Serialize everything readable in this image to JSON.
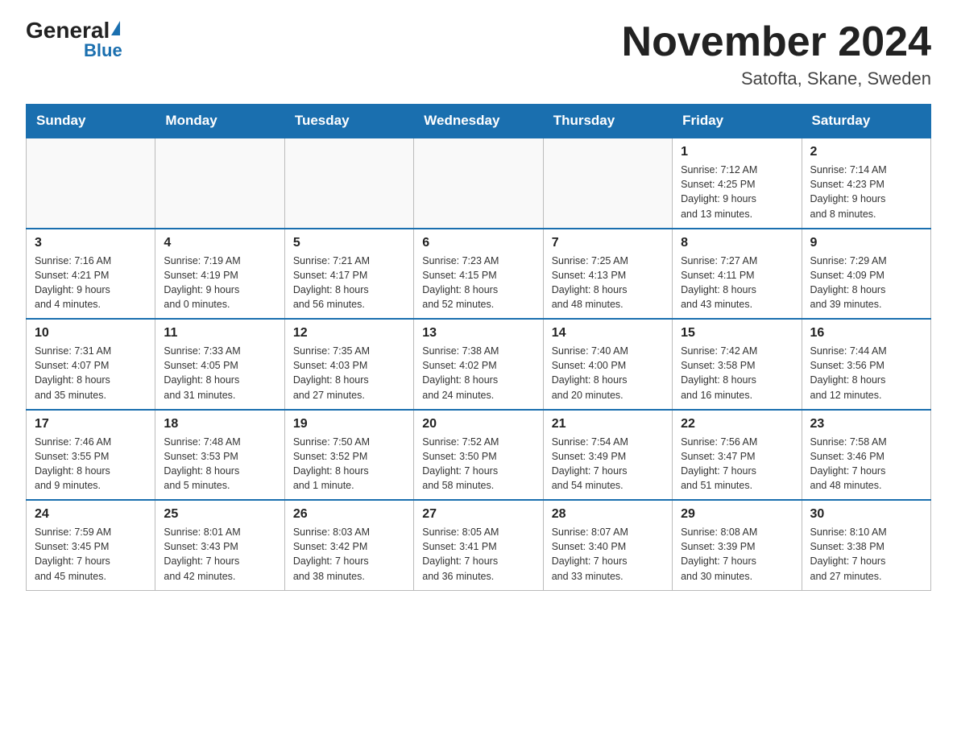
{
  "logo": {
    "general": "General",
    "blue": "Blue"
  },
  "title": "November 2024",
  "subtitle": "Satofta, Skane, Sweden",
  "days_of_week": [
    "Sunday",
    "Monday",
    "Tuesday",
    "Wednesday",
    "Thursday",
    "Friday",
    "Saturday"
  ],
  "weeks": [
    [
      {
        "day": "",
        "info": ""
      },
      {
        "day": "",
        "info": ""
      },
      {
        "day": "",
        "info": ""
      },
      {
        "day": "",
        "info": ""
      },
      {
        "day": "",
        "info": ""
      },
      {
        "day": "1",
        "info": "Sunrise: 7:12 AM\nSunset: 4:25 PM\nDaylight: 9 hours\nand 13 minutes."
      },
      {
        "day": "2",
        "info": "Sunrise: 7:14 AM\nSunset: 4:23 PM\nDaylight: 9 hours\nand 8 minutes."
      }
    ],
    [
      {
        "day": "3",
        "info": "Sunrise: 7:16 AM\nSunset: 4:21 PM\nDaylight: 9 hours\nand 4 minutes."
      },
      {
        "day": "4",
        "info": "Sunrise: 7:19 AM\nSunset: 4:19 PM\nDaylight: 9 hours\nand 0 minutes."
      },
      {
        "day": "5",
        "info": "Sunrise: 7:21 AM\nSunset: 4:17 PM\nDaylight: 8 hours\nand 56 minutes."
      },
      {
        "day": "6",
        "info": "Sunrise: 7:23 AM\nSunset: 4:15 PM\nDaylight: 8 hours\nand 52 minutes."
      },
      {
        "day": "7",
        "info": "Sunrise: 7:25 AM\nSunset: 4:13 PM\nDaylight: 8 hours\nand 48 minutes."
      },
      {
        "day": "8",
        "info": "Sunrise: 7:27 AM\nSunset: 4:11 PM\nDaylight: 8 hours\nand 43 minutes."
      },
      {
        "day": "9",
        "info": "Sunrise: 7:29 AM\nSunset: 4:09 PM\nDaylight: 8 hours\nand 39 minutes."
      }
    ],
    [
      {
        "day": "10",
        "info": "Sunrise: 7:31 AM\nSunset: 4:07 PM\nDaylight: 8 hours\nand 35 minutes."
      },
      {
        "day": "11",
        "info": "Sunrise: 7:33 AM\nSunset: 4:05 PM\nDaylight: 8 hours\nand 31 minutes."
      },
      {
        "day": "12",
        "info": "Sunrise: 7:35 AM\nSunset: 4:03 PM\nDaylight: 8 hours\nand 27 minutes."
      },
      {
        "day": "13",
        "info": "Sunrise: 7:38 AM\nSunset: 4:02 PM\nDaylight: 8 hours\nand 24 minutes."
      },
      {
        "day": "14",
        "info": "Sunrise: 7:40 AM\nSunset: 4:00 PM\nDaylight: 8 hours\nand 20 minutes."
      },
      {
        "day": "15",
        "info": "Sunrise: 7:42 AM\nSunset: 3:58 PM\nDaylight: 8 hours\nand 16 minutes."
      },
      {
        "day": "16",
        "info": "Sunrise: 7:44 AM\nSunset: 3:56 PM\nDaylight: 8 hours\nand 12 minutes."
      }
    ],
    [
      {
        "day": "17",
        "info": "Sunrise: 7:46 AM\nSunset: 3:55 PM\nDaylight: 8 hours\nand 9 minutes."
      },
      {
        "day": "18",
        "info": "Sunrise: 7:48 AM\nSunset: 3:53 PM\nDaylight: 8 hours\nand 5 minutes."
      },
      {
        "day": "19",
        "info": "Sunrise: 7:50 AM\nSunset: 3:52 PM\nDaylight: 8 hours\nand 1 minute."
      },
      {
        "day": "20",
        "info": "Sunrise: 7:52 AM\nSunset: 3:50 PM\nDaylight: 7 hours\nand 58 minutes."
      },
      {
        "day": "21",
        "info": "Sunrise: 7:54 AM\nSunset: 3:49 PM\nDaylight: 7 hours\nand 54 minutes."
      },
      {
        "day": "22",
        "info": "Sunrise: 7:56 AM\nSunset: 3:47 PM\nDaylight: 7 hours\nand 51 minutes."
      },
      {
        "day": "23",
        "info": "Sunrise: 7:58 AM\nSunset: 3:46 PM\nDaylight: 7 hours\nand 48 minutes."
      }
    ],
    [
      {
        "day": "24",
        "info": "Sunrise: 7:59 AM\nSunset: 3:45 PM\nDaylight: 7 hours\nand 45 minutes."
      },
      {
        "day": "25",
        "info": "Sunrise: 8:01 AM\nSunset: 3:43 PM\nDaylight: 7 hours\nand 42 minutes."
      },
      {
        "day": "26",
        "info": "Sunrise: 8:03 AM\nSunset: 3:42 PM\nDaylight: 7 hours\nand 38 minutes."
      },
      {
        "day": "27",
        "info": "Sunrise: 8:05 AM\nSunset: 3:41 PM\nDaylight: 7 hours\nand 36 minutes."
      },
      {
        "day": "28",
        "info": "Sunrise: 8:07 AM\nSunset: 3:40 PM\nDaylight: 7 hours\nand 33 minutes."
      },
      {
        "day": "29",
        "info": "Sunrise: 8:08 AM\nSunset: 3:39 PM\nDaylight: 7 hours\nand 30 minutes."
      },
      {
        "day": "30",
        "info": "Sunrise: 8:10 AM\nSunset: 3:38 PM\nDaylight: 7 hours\nand 27 minutes."
      }
    ]
  ]
}
